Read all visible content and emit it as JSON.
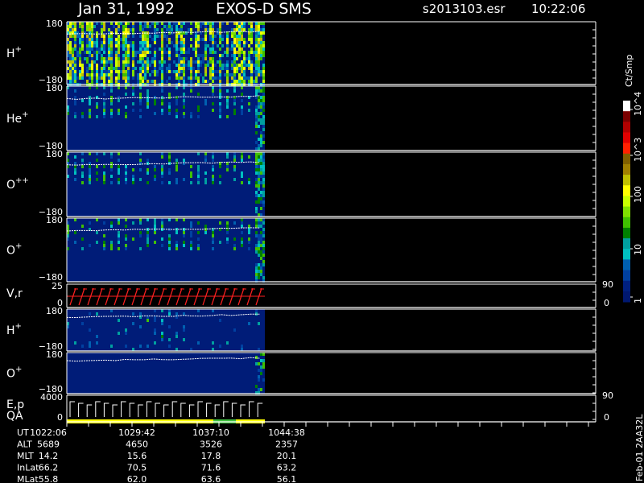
{
  "header": {
    "date": "Jan 31, 1992",
    "instrument": "EXOS-D SMS",
    "file": "s2013103.esr",
    "time": "10:22:06"
  },
  "colorbar": {
    "unit": "Ct/Smp",
    "ticks": [
      "10^4",
      "10^3",
      "100",
      "10",
      "1"
    ],
    "colors": [
      "#ffffff",
      "#7a0000",
      "#b00000",
      "#e00000",
      "#ff2000",
      "#806000",
      "#a08000",
      "#c0c000",
      "#ffff00",
      "#c8ff00",
      "#80e000",
      "#40c000",
      "#008000",
      "#00a0a0",
      "#00c0c0",
      "#0060b0",
      "#0040a0",
      "#002080",
      "#001870"
    ]
  },
  "panels": [
    {
      "id": "h-plus",
      "label": "H",
      "sup": "+",
      "ytop": "180",
      "ybot": "−180"
    },
    {
      "id": "he-plus",
      "label": "He",
      "sup": "+",
      "ytop": "180",
      "ybot": "−180"
    },
    {
      "id": "o-plusplus",
      "label": "O",
      "sup": "++",
      "ytop": "180",
      "ybot": "−180"
    },
    {
      "id": "o-plus",
      "label": "O",
      "sup": "+",
      "ytop": "180",
      "ybot": "−180"
    },
    {
      "id": "vr",
      "label": "V,r",
      "sup": "",
      "ytop": "25",
      "ybot": "0",
      "rtop": "90",
      "rbot": "0"
    },
    {
      "id": "h-plus-2",
      "label": "H",
      "sup": "+",
      "ytop": "180",
      "ybot": "−180"
    },
    {
      "id": "o-plus-2",
      "label": "O",
      "sup": "+",
      "ytop": "180",
      "ybot": "−180"
    },
    {
      "id": "ep",
      "label": "E,p",
      "sup": "",
      "ytop": "4000",
      "ybot": "0",
      "rtop": "90",
      "rbot": "0"
    }
  ],
  "qa_label": "QA",
  "footer": {
    "rows": [
      {
        "label": "UT",
        "values": [
          "1022:06",
          "1029:42",
          "1037:10",
          "1044:38"
        ]
      },
      {
        "label": "ALT",
        "values": [
          "5689",
          "4650",
          "3526",
          "2357"
        ]
      },
      {
        "label": "MLT",
        "values": [
          "14.2",
          "15.6",
          "17.8",
          "20.1"
        ]
      },
      {
        "label": "InLat",
        "values": [
          "66.2",
          "70.5",
          "71.6",
          "63.2"
        ]
      },
      {
        "label": "MLat",
        "values": [
          "55.8",
          "62.0",
          "63.6",
          "56.1"
        ]
      }
    ],
    "side_label": "Feb-01 2AA32L"
  },
  "chart_data": {
    "type": "heatmap",
    "title": "Jan 31, 1992   EXOS-D SMS",
    "x_ticks": [
      "1022:06",
      "1029:42",
      "1037:10",
      "1044:38"
    ],
    "series": [
      {
        "name": "H+",
        "ylim": [
          -180,
          180
        ]
      },
      {
        "name": "He+",
        "ylim": [
          -180,
          180
        ]
      },
      {
        "name": "O++",
        "ylim": [
          -180,
          180
        ]
      },
      {
        "name": "O+",
        "ylim": [
          -180,
          180
        ]
      },
      {
        "name": "V,r",
        "ylim": [
          0,
          25
        ]
      },
      {
        "name": "H+",
        "ylim": [
          -180,
          180
        ]
      },
      {
        "name": "O+",
        "ylim": [
          -180,
          180
        ]
      },
      {
        "name": "E,p",
        "ylim": [
          0,
          4000
        ]
      }
    ],
    "colorscale": "log",
    "colorbar_range": [
      1,
      10000
    ]
  }
}
